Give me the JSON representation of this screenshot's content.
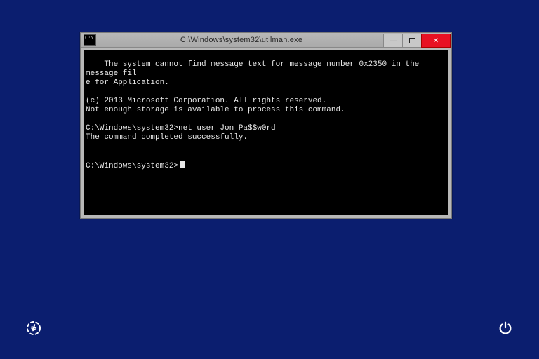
{
  "window": {
    "title": "C:\\Windows\\system32\\utilman.exe",
    "console_lines": [
      "The system cannot find message text for message number 0x2350 in the message fil",
      "e for Application.",
      "",
      "(c) 2013 Microsoft Corporation. All rights reserved.",
      "Not enough storage is available to process this command.",
      "",
      "C:\\Windows\\system32>net user Jon Pa$$w0rd",
      "The command completed successfully.",
      "",
      "",
      "C:\\Windows\\system32>"
    ]
  },
  "controls": {
    "minimize_glyph": "—",
    "close_glyph": "✕"
  },
  "icons": {
    "ease_of_access": "ease-of-access-icon",
    "power": "power-icon",
    "cmd": "cmd-icon"
  }
}
